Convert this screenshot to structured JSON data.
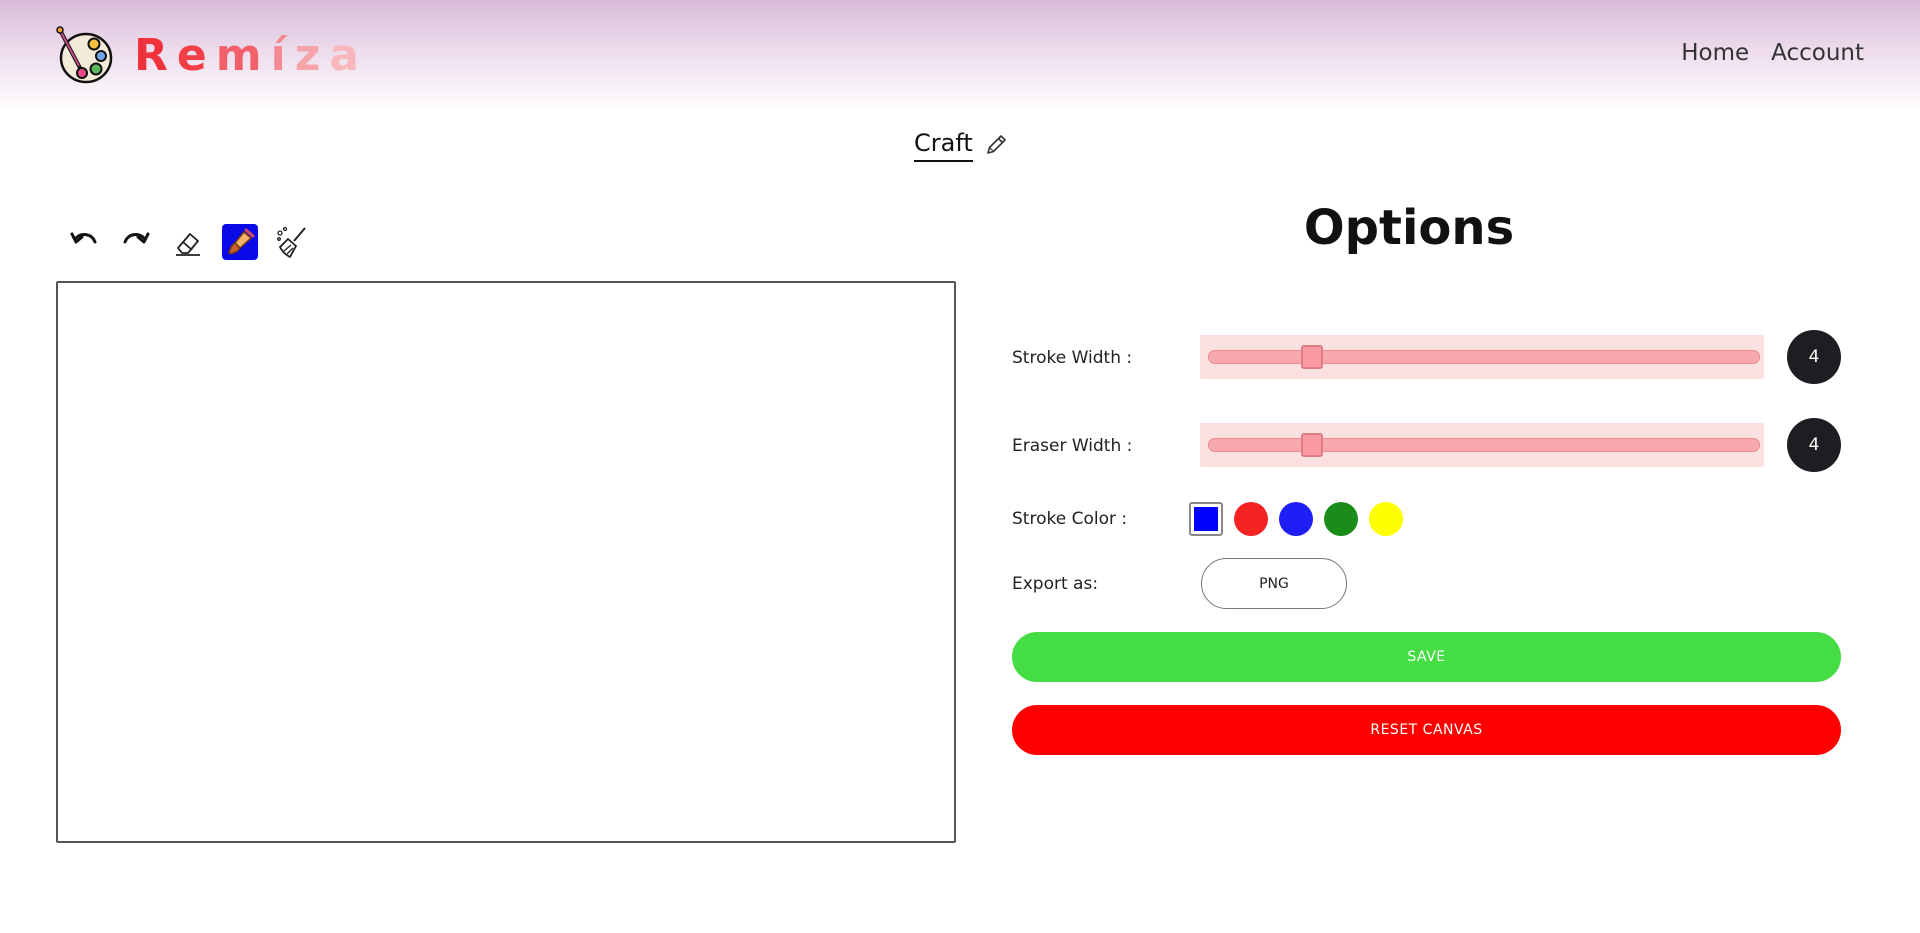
{
  "header": {
    "brand": [
      "R",
      "e",
      "m",
      "í",
      "z",
      "a"
    ],
    "brand_colors": [
      "#f0323c",
      "#f23e47",
      "#f26169",
      "#f48a91",
      "#f6a4aa",
      "#f7b7bc"
    ],
    "logo_icon": "palette-icon",
    "nav": [
      "Home",
      "Account"
    ]
  },
  "document": {
    "title": "Craft",
    "edit_icon": "pencil-icon"
  },
  "toolbar": {
    "tools": [
      {
        "name": "undo-icon",
        "active": false
      },
      {
        "name": "redo-icon",
        "active": false
      },
      {
        "name": "eraser-icon",
        "active": false
      },
      {
        "name": "brush-icon",
        "active": true
      },
      {
        "name": "broom-icon",
        "active": false
      }
    ]
  },
  "options": {
    "title": "Options",
    "stroke_width": {
      "label": "Stroke Width :",
      "value": "4",
      "fraction": 0.175
    },
    "eraser_width": {
      "label": "Eraser Width :",
      "value": "4",
      "fraction": 0.175
    },
    "stroke_color": {
      "label": "Stroke Color :",
      "selected": "#0000ff",
      "swatches": [
        "#f52222",
        "#1e1ef5",
        "#1a8c1a",
        "#ffff00"
      ]
    },
    "export": {
      "label": "Export as:",
      "format": "PNG"
    },
    "save_label": "SAVE",
    "save_color": "#44dd44",
    "reset_label": "RESET CANVAS",
    "reset_color": "#ff0000"
  }
}
